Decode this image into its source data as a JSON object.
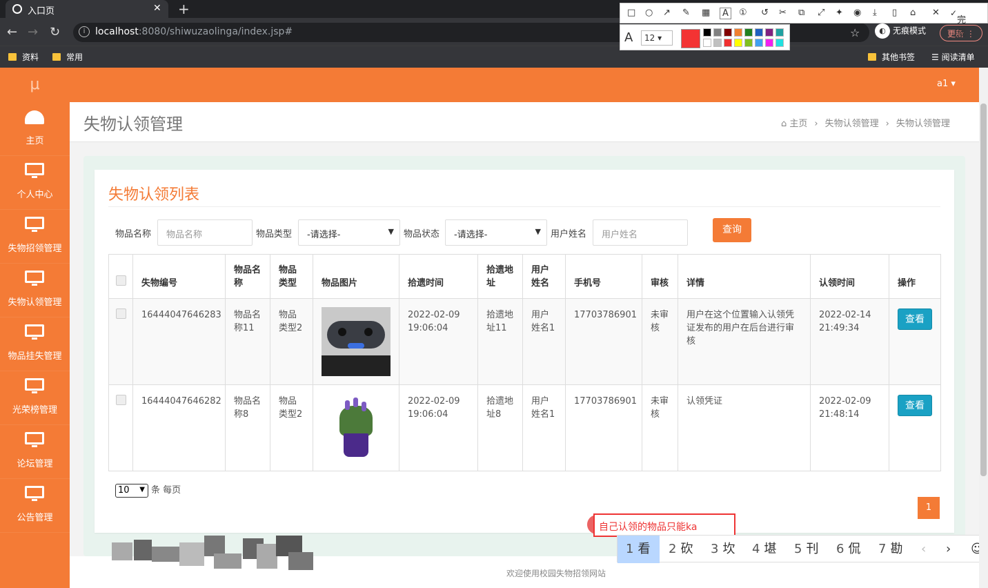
{
  "browser": {
    "tab_title": "入口页",
    "tab_close": "✕",
    "new_tab": "+",
    "url_host": "localhost",
    "url_rest": ":8080/shiwuzaolinga/index.jsp#",
    "incognito_label": "无痕模式",
    "update_label": "更新",
    "bookmarks": [
      "资料",
      "常用"
    ],
    "other_bookmarks": "其他书签",
    "reading_list": "阅读清单"
  },
  "screenshot_tool": {
    "done_label": "完成",
    "font_size": "12",
    "current_color": "#f33333",
    "palette": [
      "#000000",
      "#808080",
      "#800000",
      "#f08030",
      "#208020",
      "#2060c0",
      "#802080",
      "#20a0a0",
      "#ffffff",
      "#c0c0c0",
      "#f03030",
      "#ffff00",
      "#80c020",
      "#40a0f0",
      "#f020f0",
      "#20e0e0"
    ]
  },
  "app": {
    "logo": "μ",
    "user": "a1 ▾",
    "sidebar": [
      {
        "label": "主页"
      },
      {
        "label": "个人中心"
      },
      {
        "label": "失物招领管理"
      },
      {
        "label": "失物认领管理"
      },
      {
        "label": "物品挂失管理"
      },
      {
        "label": "光荣榜管理"
      },
      {
        "label": "论坛管理"
      },
      {
        "label": "公告管理"
      }
    ],
    "page_title": "失物认领管理",
    "breadcrumb": {
      "home": "主页",
      "level1": "失物认领管理",
      "level2": "失物认领管理"
    },
    "card_title": "失物认领列表",
    "filters": {
      "name_label": "物品名称",
      "name_placeholder": "物品名称",
      "type_label": "物品类型",
      "type_value": "-请选择-",
      "status_label": "物品状态",
      "status_value": "-请选择-",
      "user_label": "用户姓名",
      "user_placeholder": "用户姓名",
      "query_button": "查询"
    },
    "table": {
      "headers": {
        "id": "失物编号",
        "name": "物品名称",
        "type": "物品类型",
        "image": "物品图片",
        "pick_time": "拾遗时间",
        "pick_addr": "拾遗地址",
        "user": "用户姓名",
        "phone": "手机号",
        "audit": "审核",
        "detail": "详情",
        "claim_time": "认领时间",
        "action": "操作"
      },
      "rows": [
        {
          "id": "16444047646283",
          "name": "物品名称11",
          "type": "物品类型2",
          "image": "game-controller",
          "pick_time": "2022-02-09 19:06:04",
          "pick_addr": "拾遗地址11",
          "user": "用户姓名1",
          "phone": "17703786901",
          "audit": "未审核",
          "detail": "用户在这个位置输入认领凭证发布的用户在后台进行审核",
          "claim_time": "2022-02-14 21:49:34",
          "action": "查看"
        },
        {
          "id": "16444047646282",
          "name": "物品名称8",
          "type": "物品类型2",
          "image": "potted-plant",
          "pick_time": "2022-02-09 19:06:04",
          "pick_addr": "拾遗地址8",
          "user": "用户姓名1",
          "phone": "17703786901",
          "audit": "未审核",
          "detail": "认领凭证",
          "claim_time": "2022-02-09 21:48:14",
          "action": "查看"
        }
      ]
    },
    "per_page_value": "10",
    "per_page_label": "条 每页",
    "current_page": "1",
    "footer": "欢迎使用校园失物招领网站"
  },
  "ime": {
    "composition": "自己认领的物品只能ka",
    "candidates": [
      {
        "n": "1",
        "c": "看"
      },
      {
        "n": "2",
        "c": "砍"
      },
      {
        "n": "3",
        "c": "坎"
      },
      {
        "n": "4",
        "c": "堪"
      },
      {
        "n": "5",
        "c": "刊"
      },
      {
        "n": "6",
        "c": "侃"
      },
      {
        "n": "7",
        "c": "勘"
      }
    ],
    "prev": "‹",
    "next": "›",
    "emoji": "☺"
  }
}
